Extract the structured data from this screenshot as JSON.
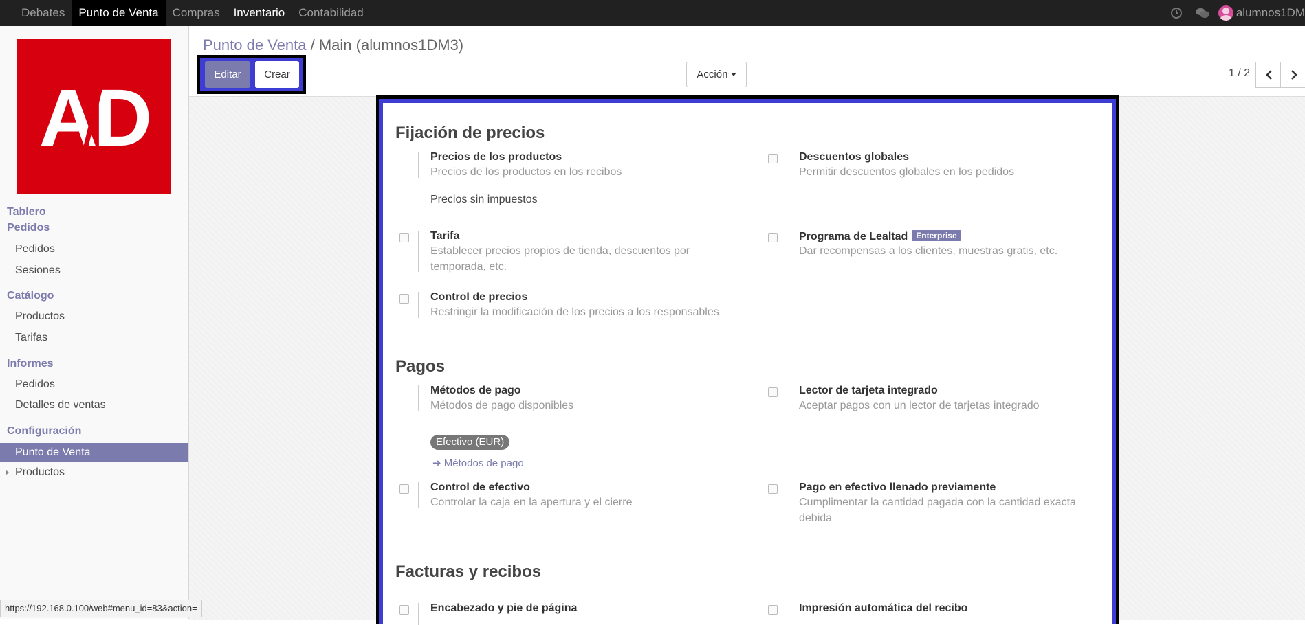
{
  "topbar": {
    "menu": [
      "Debates",
      "Punto de Venta",
      "Compras",
      "Inventario",
      "Contabilidad"
    ],
    "user": "alumnos1DM"
  },
  "sidebar": {
    "tablero": "Tablero",
    "pedidos_section": "Pedidos",
    "pedidos_items": [
      "Pedidos",
      "Sesiones"
    ],
    "catalogo_section": "Catálogo",
    "catalogo_items": [
      "Productos",
      "Tarifas"
    ],
    "informes_section": "Informes",
    "informes_items": [
      "Pedidos",
      "Detalles de ventas"
    ],
    "config_section": "Configuración",
    "config_items": [
      "Punto de Venta",
      "Productos"
    ]
  },
  "breadcrumb": {
    "parent": "Punto de Venta",
    "separator": "/",
    "current": "Main (alumnos1DM3)"
  },
  "buttons": {
    "edit": "Editar",
    "create": "Crear",
    "action": "Acción"
  },
  "pager": {
    "value": "1 / 2"
  },
  "sections": {
    "pricing": {
      "title": "Fijación de precios",
      "product_prices": {
        "title": "Precios de los productos",
        "desc": "Precios de los productos en los recibos",
        "value": "Precios sin impuestos"
      },
      "global_discounts": {
        "title": "Descuentos globales",
        "desc": "Permitir descuentos globales en los pedidos"
      },
      "tarifa": {
        "title": "Tarifa",
        "desc": "Establecer precios propios de tienda, descuentos por temporada, etc."
      },
      "loyalty": {
        "title": "Programa de Lealtad",
        "badge": "Enterprise",
        "desc": "Dar recompensas a los clientes, muestras gratis, etc."
      },
      "price_control": {
        "title": "Control de precios",
        "desc": "Restringir la modificación de los precios a los responsables"
      }
    },
    "payments": {
      "title": "Pagos",
      "methods": {
        "title": "Métodos de pago",
        "desc": "Métodos de pago disponibles",
        "tag": "Efectivo (EUR)",
        "link": "Métodos de pago"
      },
      "card_reader": {
        "title": "Lector de tarjeta integrado",
        "desc": "Aceptar pagos con un lector de tarjetas integrado"
      },
      "cash_control": {
        "title": "Control de efectivo",
        "desc": "Controlar la caja en la apertura y el cierre"
      },
      "prefill_cash": {
        "title": "Pago en efectivo llenado previamente",
        "desc": "Cumplimentar la cantidad pagada con la cantidad exacta debida"
      }
    },
    "invoices": {
      "title": "Facturas y recibos",
      "header_footer": {
        "title": "Encabezado y pie de página"
      },
      "auto_print": {
        "title": "Impresión automática del recibo"
      }
    }
  },
  "status_url": "https://192.168.0.100/web#menu_id=83&action="
}
